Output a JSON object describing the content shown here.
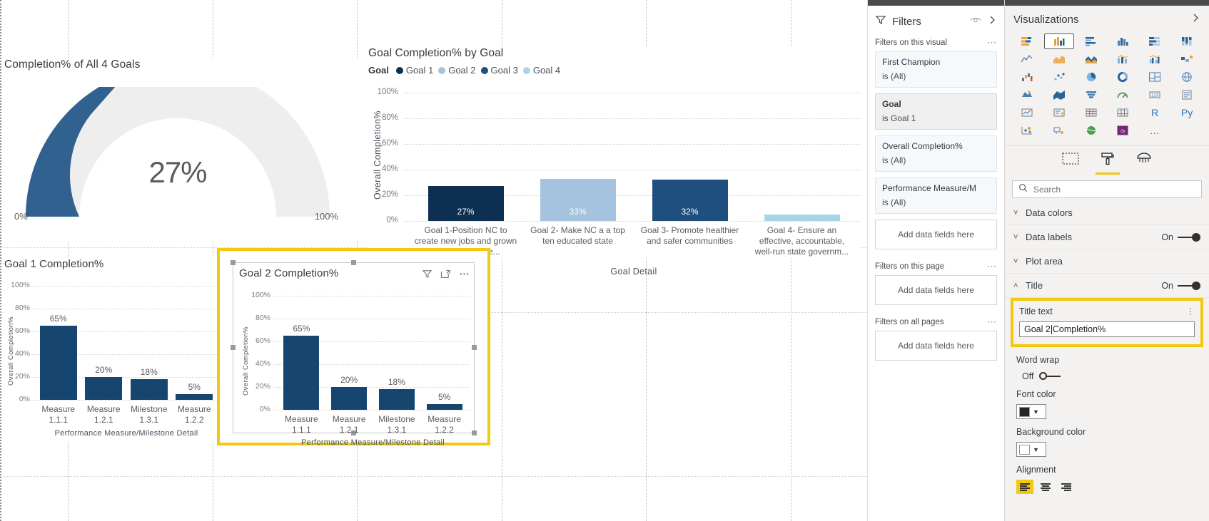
{
  "canvas": {
    "gauge": {
      "title": "Completion% of All 4 Goals",
      "value_label": "27%",
      "min_label": "0%",
      "max_label": "100%",
      "value": 27,
      "fill_color": "#31628f",
      "track_color": "#eeeeee"
    },
    "goal_chart": {
      "title": "Goal Completion% by Goal",
      "legend_title": "Goal",
      "y_axis_title": "Overall Completion%",
      "x_axis_title": "Goal Detail"
    },
    "goal1": {
      "title": "Goal 1 Completion%"
    },
    "goal2": {
      "title": "Goal 2 Completion%"
    }
  },
  "chart_data": [
    {
      "type": "gauge",
      "title": "Completion% of All 4 Goals",
      "value": 27,
      "min": 0,
      "max": 100,
      "value_label": "27%",
      "min_label": "0%",
      "max_label": "100%"
    },
    {
      "type": "bar",
      "title": "Goal Completion% by Goal",
      "xlabel": "Goal Detail",
      "ylabel": "Overall Completion%",
      "ylim": [
        0,
        100
      ],
      "yticks": [
        "0%",
        "20%",
        "40%",
        "60%",
        "80%",
        "100%"
      ],
      "grid": true,
      "legend_position": "top",
      "legend_title": "Goal",
      "legend": [
        {
          "name": "Goal 1",
          "color": "#0d2f52"
        },
        {
          "name": "Goal 2",
          "color": "#a5c3de"
        },
        {
          "name": "Goal 3",
          "color": "#1f4f7f"
        },
        {
          "name": "Goal 4",
          "color": "#a8d5e5"
        }
      ],
      "categories": [
        "Goal 1-Position NC to create new jobs and grown workers' payche...",
        "Goal 2- Make NC a a top ten educated state",
        "Goal 3- Promote healthier and safer communities",
        "Goal 4- Ensure an effective, accountable, well-run state governm..."
      ],
      "values": [
        27,
        33,
        32,
        5
      ],
      "data_labels": [
        "27%",
        "33%",
        "32%",
        ""
      ],
      "colors": [
        "#0d2f52",
        "#a5c3de",
        "#1f4f7f",
        "#a8d5e5"
      ]
    },
    {
      "type": "bar",
      "title": "Goal 1 Completion%",
      "xlabel": "Performance Measure/Milestone Detail",
      "ylabel": "Overall Completion%",
      "ylim": [
        0,
        100
      ],
      "yticks": [
        "0%",
        "20%",
        "40%",
        "60%",
        "80%",
        "100%"
      ],
      "grid": true,
      "categories": [
        "Measure 1.1.1",
        "Measure 1.2.1",
        "Milestone 1.3.1",
        "Measure 1.2.2"
      ],
      "category_lines": [
        [
          "Measure",
          "1.1.1"
        ],
        [
          "Measure",
          "1.2.1"
        ],
        [
          "Milestone",
          "1.3.1"
        ],
        [
          "Measure",
          "1.2.2"
        ]
      ],
      "values": [
        65,
        20,
        18,
        5
      ],
      "data_labels": [
        "65%",
        "20%",
        "18%",
        "5%"
      ],
      "color": "#16456f"
    },
    {
      "type": "bar",
      "title": "Goal 2 Completion%",
      "xlabel": "Performance Measure/Milestone Detail",
      "ylabel": "Overall Completion%",
      "ylim": [
        0,
        100
      ],
      "yticks": [
        "0%",
        "20%",
        "40%",
        "60%",
        "80%",
        "100%"
      ],
      "grid": true,
      "categories": [
        "Measure 1.1.1",
        "Measure 1.2.1",
        "Milestone 1.3.1",
        "Measure 1.2.2"
      ],
      "category_lines": [
        [
          "Measure",
          "1.1.1"
        ],
        [
          "Measure",
          "1.2.1"
        ],
        [
          "Milestone",
          "1.3.1"
        ],
        [
          "Measure",
          "1.2.2"
        ]
      ],
      "values": [
        65,
        20,
        18,
        5
      ],
      "data_labels": [
        "65%",
        "20%",
        "18%",
        "5%"
      ],
      "color": "#16456f"
    }
  ],
  "filters_pane": {
    "title": "Filters",
    "sections": [
      {
        "label": "Filters on this visual",
        "cards": [
          {
            "field": "First Champion",
            "value": "is (All)",
            "active": false
          },
          {
            "field": "Goal",
            "value": "is Goal 1",
            "active": true
          },
          {
            "field": "Overall Completion%",
            "value": "is (All)",
            "active": false
          },
          {
            "field": "Performance Measure/M",
            "value": "is (All)",
            "active": false
          }
        ],
        "add_label": "Add data fields here"
      },
      {
        "label": "Filters on this page",
        "cards": [],
        "add_label": "Add data fields here"
      },
      {
        "label": "Filters on all pages",
        "cards": [],
        "add_label": "Add data fields here"
      }
    ]
  },
  "viz_pane": {
    "title": "Visualizations",
    "r_label": "R",
    "py_label": "Py",
    "more_label": "...",
    "tabs": [
      {
        "name": "fields-tab",
        "active": false
      },
      {
        "name": "format-tab",
        "active": true
      },
      {
        "name": "analytics-tab",
        "active": false
      }
    ],
    "search": {
      "placeholder": "Search",
      "value": ""
    },
    "format_rows": [
      {
        "label": "Data colors",
        "toggle": null
      },
      {
        "label": "Data labels",
        "toggle": "On"
      },
      {
        "label": "Plot area",
        "toggle": null
      },
      {
        "label": "Title",
        "toggle": "On"
      }
    ],
    "title_section": {
      "title_text_label": "Title text",
      "title_text_value_before": "Goal 2",
      "title_text_value_after": "Completion%",
      "word_wrap_label": "Word wrap",
      "word_wrap_state": "Off",
      "font_color_label": "Font color",
      "font_color_value": "#252423",
      "background_color_label": "Background color",
      "background_color_value": "#ffffff",
      "alignment_label": "Alignment"
    },
    "accent_color": "#f2c811"
  }
}
